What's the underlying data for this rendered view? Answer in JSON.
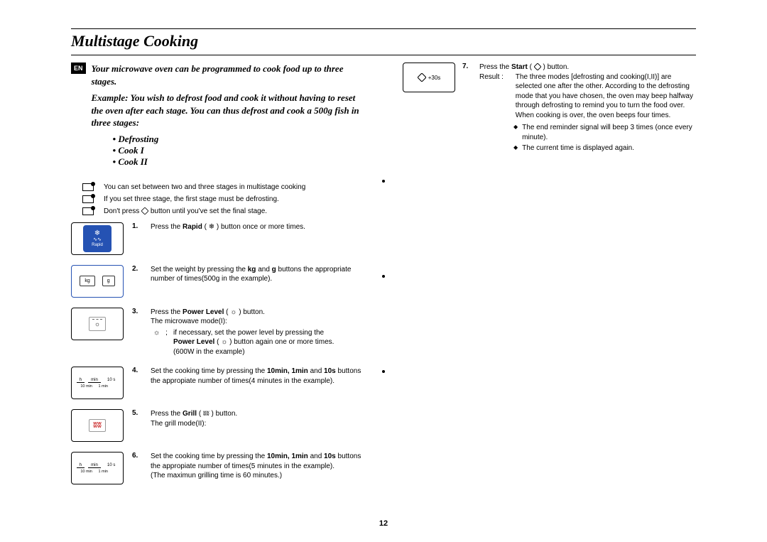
{
  "title": "Multistage Cooking",
  "lang_badge": "EN",
  "intro_paragraph": "Your microwave oven can be programmed to cook food up to three stages.",
  "example_paragraph": "Example: You wish to defrost food and cook it without having to reset the oven after each stage. You can thus defrost and cook a 500g fish in three stages:",
  "stage_bullets": [
    "Defrosting",
    "Cook I",
    "Cook II"
  ],
  "notes": [
    "You can set between two and three stages in multistage cooking",
    "If you set three stage, the first stage must be defrosting.",
    "Don't press        button until you've set the final stage."
  ],
  "note3_prefix": "Don't press ",
  "note3_suffix": " button until you've set the final stage.",
  "steps": {
    "s1": {
      "num": "1.",
      "prefix": "Press the ",
      "bold": "Rapid",
      "suffix": " (        ) button once or more times."
    },
    "s2": {
      "num": "2.",
      "prefix": "Set the weight by pressing the ",
      "b1": "kg",
      "mid": " and ",
      "b2": "g",
      "suffix": " buttons the appropriate number of times(500g in the example)."
    },
    "s3": {
      "num": "3.",
      "prefix": "Press the ",
      "bold": "Power Level",
      "suffix": " (        ) button.",
      "line2": "The microwave mode(I):",
      "sub_prefix": "if necessary, set the power level by pressing the",
      "sub_bold": "Power Level",
      "sub_mid": " (        ) button again one or more times.",
      "sub_last": "(600W in the example)"
    },
    "s4": {
      "num": "4.",
      "prefix": "Set the cooking time by pressing the ",
      "b1": "10min, 1min",
      "mid": " and ",
      "b2": "10s",
      "suffix": " buttons the appropiate number of times(4 minutes in the example)."
    },
    "s5": {
      "num": "5.",
      "prefix": "Press the ",
      "bold": "Grill",
      "suffix": " (        ) button.",
      "line2": "The grill mode(II):"
    },
    "s6": {
      "num": "6.",
      "prefix": "Set the cooking time by pressing the ",
      "b1": "10min, 1min",
      "mid": " and ",
      "b2": "10s",
      "suffix": " buttons the appropiate number of times(5 minutes in the example).",
      "line2": "(The maximun grilling time is 60 minutes.)"
    },
    "s7": {
      "num": "7.",
      "prefix": "Press the ",
      "bold": "Start",
      "suffix": " (        ) button.",
      "result_label": "Result :",
      "result_text": "The three modes [defrosting and cooking(I,II)] are selected one after the other. According to the defrosting mode that you have chosen, the oven may beep halfway through defrosting to remind you to turn the food over. When cooking is over, the oven beeps four times.",
      "bul1": "The end reminder signal will beep 3 times (once every minute).",
      "bul2": "The current time is displayed again."
    }
  },
  "fig": {
    "rapid": "Rapid",
    "rapid_sym": "❄",
    "kg": "kg",
    "g": "g",
    "time_h": "h",
    "time_min": "min",
    "time_10s": "10 s",
    "time_10min": "10 min",
    "time_1min": "1 min",
    "start_label": "+30s"
  },
  "page_number": "12"
}
